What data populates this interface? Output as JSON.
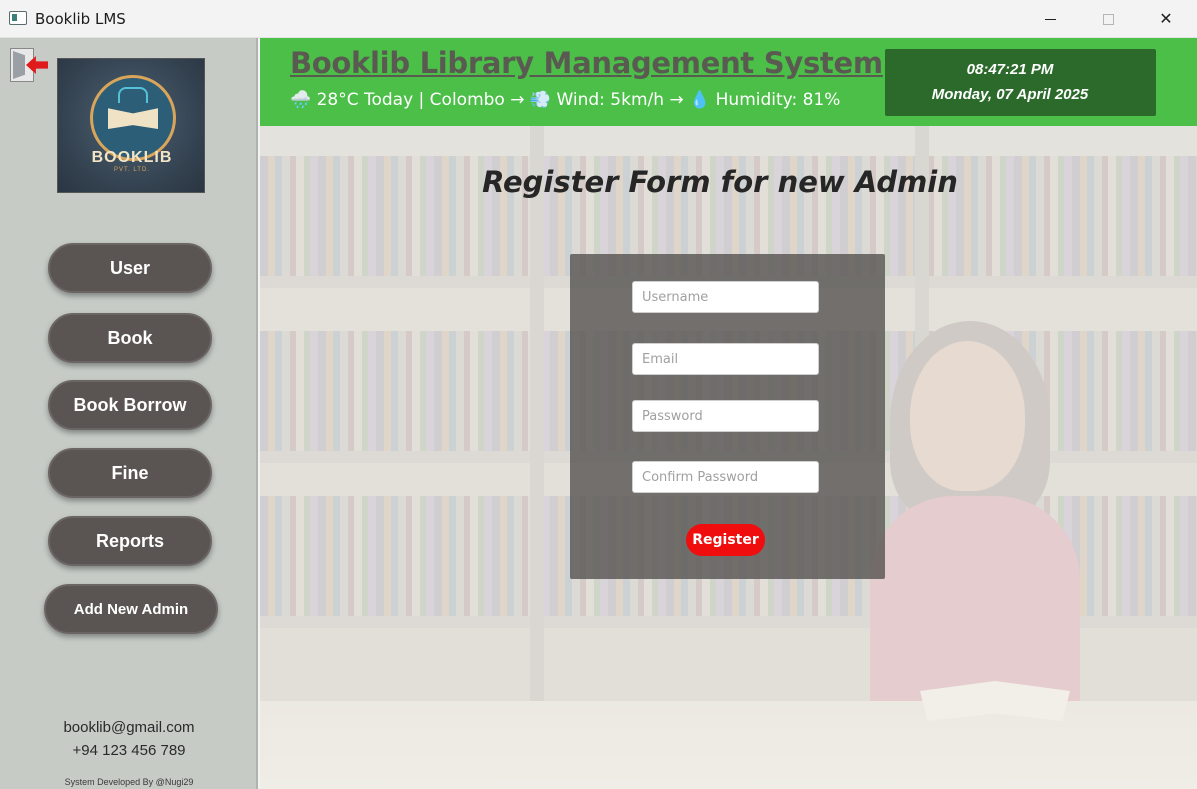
{
  "window": {
    "title": "Booklib LMS",
    "minimize_symbol": "",
    "close_symbol": "✕"
  },
  "sidebar": {
    "logo": {
      "text": "BOOKLIB",
      "subtext": "PVT. LTD."
    },
    "nav": [
      {
        "label": "User"
      },
      {
        "label": "Book"
      },
      {
        "label": "Book Borrow"
      },
      {
        "label": "Fine"
      },
      {
        "label": "Reports"
      },
      {
        "label": "Add New Admin"
      }
    ],
    "contact": {
      "email": "booklib@gmail.com",
      "phone": "+94 123 456 789"
    },
    "credit": "System Developed By @Nugi29"
  },
  "header": {
    "title": "Booklib Library Management System",
    "weather": "🌧️ 28°C Today | Colombo → 💨 Wind: 5km/h → 💧 Humidity: 81%",
    "time": "08:47:21 PM",
    "date": "Monday, 07 April 2025",
    "background_color": "#4bbf47",
    "clock_color": "#2b6a2b"
  },
  "form": {
    "title": "Register Form for new Admin",
    "username_placeholder": "Username",
    "email_placeholder": "Email",
    "password_placeholder": "Password",
    "confirm_placeholder": "Confirm Password",
    "username_value": "",
    "email_value": "",
    "password_value": "",
    "confirm_value": "",
    "register_label": "Register",
    "register_color": "#f00d0d"
  },
  "icons": {
    "app": "app-window-icon",
    "back": "exit-door-icon",
    "logo": "booklib-logo"
  }
}
